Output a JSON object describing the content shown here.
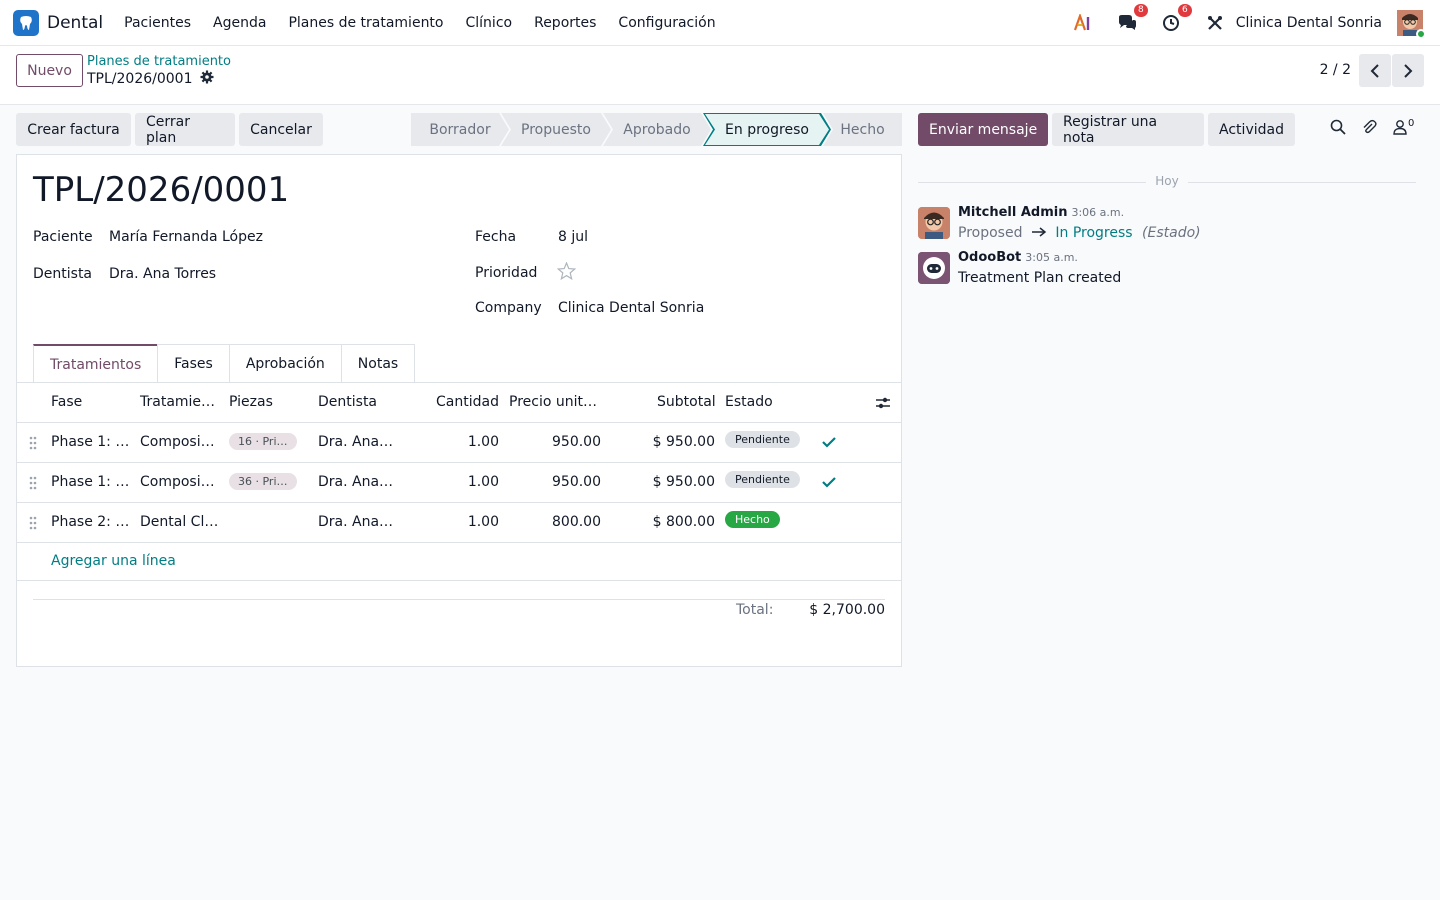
{
  "app": {
    "name": "Dental"
  },
  "menu": [
    "Pacientes",
    "Agenda",
    "Planes de tratamiento",
    "Clínico",
    "Reportes",
    "Configuración"
  ],
  "nav": {
    "messages_count": "8",
    "activities_count": "6",
    "company": "Clinica Dental Sonria"
  },
  "control": {
    "new_label": "Nuevo",
    "breadcrumb_parent": "Planes de tratamiento",
    "breadcrumb_current": "TPL/2026/0001",
    "pager": "2 / 2"
  },
  "actions": {
    "invoice": "Crear factura",
    "close": "Cerrar plan",
    "cancel": "Cancelar"
  },
  "stages": [
    "Borrador",
    "Propuesto",
    "Aprobado",
    "En progreso",
    "Hecho"
  ],
  "active_stage": "En progreso",
  "record": {
    "title": "TPL/2026/0001",
    "patient_label": "Paciente",
    "patient": "María Fernanda López",
    "dentist_label": "Dentista",
    "dentist": "Dra. Ana Torres",
    "date_label": "Fecha",
    "date": "8 jul",
    "priority_label": "Prioridad",
    "company_label": "Company",
    "company": "Clinica Dental Sonria"
  },
  "tabs": [
    "Tratamientos",
    "Fases",
    "Aprobación",
    "Notas"
  ],
  "table": {
    "headers": {
      "phase": "Fase",
      "treatment": "Tratamie…",
      "teeth": "Piezas",
      "dentist": "Dentista",
      "qty": "Cantidad",
      "price": "Precio unit…",
      "subtotal": "Subtotal",
      "status": "Estado"
    },
    "rows": [
      {
        "phase": "Phase 1: …",
        "treatment": "Composi…",
        "teeth": "16 · Pri…",
        "dentist": "Dra. Ana…",
        "qty": "1.00",
        "price": "950.00",
        "subtotal": "$ 950.00",
        "status": "Pendiente"
      },
      {
        "phase": "Phase 1: …",
        "treatment": "Composi…",
        "teeth": "36 · Pri…",
        "dentist": "Dra. Ana…",
        "qty": "1.00",
        "price": "950.00",
        "subtotal": "$ 950.00",
        "status": "Pendiente"
      },
      {
        "phase": "Phase 2: …",
        "treatment": "Dental Cl…",
        "teeth": "",
        "dentist": "Dra. Ana…",
        "qty": "1.00",
        "price": "800.00",
        "subtotal": "$ 800.00",
        "status": "Hecho"
      }
    ],
    "add_line": "Agregar una línea",
    "total_label": "Total:",
    "total_value": "$ 2,700.00"
  },
  "chatter": {
    "send_message": "Enviar mensaje",
    "log_note": "Registrar una nota",
    "activity": "Actividad",
    "followers_count": "0",
    "day": "Hoy",
    "messages": [
      {
        "author": "Mitchell Admin",
        "time": "3:06 a.m.",
        "old_value": "Proposed",
        "new_value": "In Progress",
        "field": "(Estado)"
      },
      {
        "author": "OdooBot",
        "time": "3:05 a.m.",
        "body": "Treatment Plan created"
      }
    ]
  },
  "colors": {
    "primary": "#714b67",
    "accent": "#017e84",
    "success": "#28a745",
    "badge": "#e03a3e"
  }
}
